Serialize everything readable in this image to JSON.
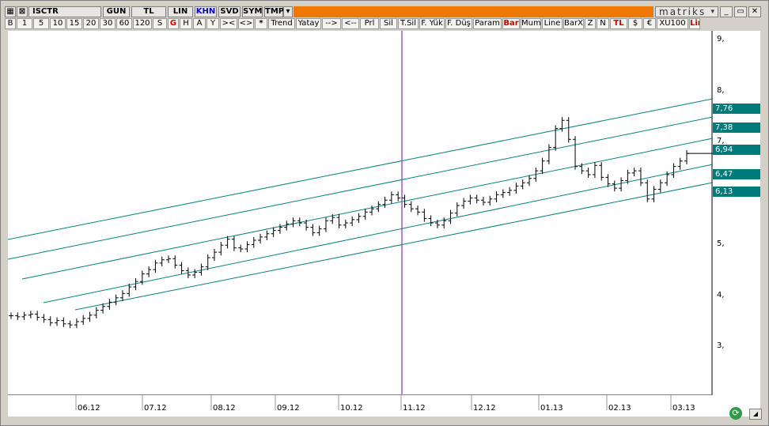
{
  "titlebar": {
    "symbol": "ISCTR",
    "period": "GUN",
    "currency": "TL",
    "scale": "LIN",
    "khn": "KHN",
    "svd": "SVD",
    "sym": "SYM",
    "tmp": "TMP",
    "brand": "matriks",
    "win_minimize": "_",
    "win_restore": "▭",
    "win_close": "✕"
  },
  "toolbar": {
    "buttons": [
      "B",
      "1",
      "5",
      "10",
      "15",
      "20",
      "30",
      "60",
      "120",
      "S",
      "G",
      "H",
      "A",
      "Y",
      "><",
      "<>",
      "*",
      "Trend",
      "Yatay",
      "-->",
      "<--",
      "Prl",
      "Sil",
      "T.Sil",
      "F. Yük",
      "F. Düş",
      "Param",
      "Bar",
      "Mum",
      "Line",
      "BarX",
      "Z",
      "N",
      "TL",
      "$",
      "€",
      "XU100",
      "Lir"
    ]
  },
  "colors": {
    "channel": "#0a7f7f",
    "tag_bg": "#007a7a",
    "vline": "#7a00a0",
    "orange_bar": "#f07800",
    "active_red": "#d00000"
  },
  "chart_data": {
    "type": "bar",
    "symbol": "ISCTR",
    "ylim": [
      2.5,
      9.2
    ],
    "y_ticks": [
      "3,",
      "4,",
      "5,",
      "7,",
      "8,",
      "9,"
    ],
    "x_ticks": [
      "06.12",
      "07.12",
      "08.12",
      "09.12",
      "10.12",
      "11.12",
      "12.12",
      "01.13",
      "02.13",
      "03.13"
    ],
    "channel_levels": [
      "7,76",
      "7,38",
      "6,94",
      "6,47",
      "6,13"
    ],
    "ohlc_close_series": [
      3.95,
      3.93,
      3.96,
      3.98,
      3.92,
      3.88,
      3.82,
      3.86,
      3.8,
      3.78,
      3.84,
      3.9,
      3.96,
      4.05,
      4.12,
      4.2,
      4.28,
      4.36,
      4.48,
      4.58,
      4.72,
      4.8,
      4.92,
      4.98,
      5.0,
      4.88,
      4.78,
      4.7,
      4.75,
      4.85,
      5.02,
      5.12,
      5.25,
      5.36,
      5.2,
      5.18,
      5.26,
      5.34,
      5.4,
      5.46,
      5.52,
      5.58,
      5.64,
      5.7,
      5.66,
      5.58,
      5.48,
      5.55,
      5.7,
      5.76,
      5.62,
      5.66,
      5.72,
      5.78,
      5.86,
      5.92,
      6.0,
      6.08,
      6.18,
      6.12,
      6.0,
      5.92,
      5.86,
      5.74,
      5.66,
      5.62,
      5.7,
      5.84,
      5.98,
      6.06,
      6.12,
      6.08,
      6.04,
      6.1,
      6.18,
      6.22,
      6.26,
      6.34,
      6.4,
      6.48,
      6.62,
      6.8,
      7.05,
      7.4,
      7.55,
      7.2,
      6.7,
      6.62,
      6.55,
      6.72,
      6.5,
      6.38,
      6.3,
      6.44,
      6.58,
      6.62,
      6.4,
      6.1,
      6.28,
      6.4,
      6.55,
      6.7,
      6.8,
      6.94
    ]
  }
}
